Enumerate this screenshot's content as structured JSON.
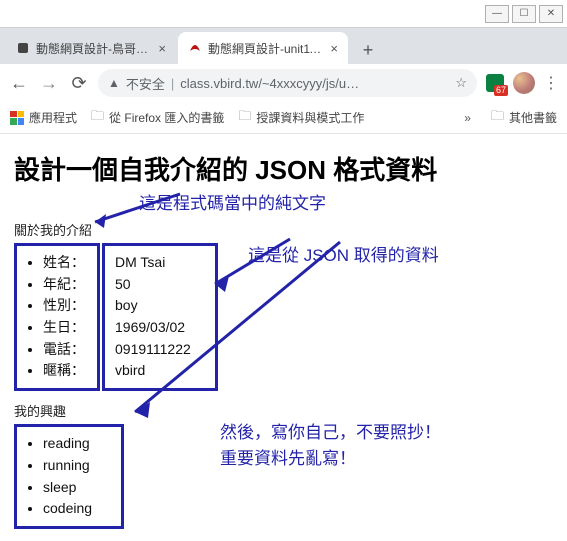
{
  "window": {
    "min": "—",
    "max": "☐",
    "close": "✕"
  },
  "tabs": [
    {
      "title": "動態網頁設計-鳥哥設…",
      "active": false
    },
    {
      "title": "動態網頁設計-unit11-1…",
      "active": true
    }
  ],
  "newtab": "+",
  "nav": {
    "back": "←",
    "forward": "→",
    "reload": "⟳"
  },
  "addr": {
    "insecure": "不安全",
    "url": "class.vbird.tw/~4xxxcyyy/js/u…",
    "star": "☆"
  },
  "ext": {
    "badge": "67"
  },
  "menu": "⋮",
  "bookmarks": {
    "apps": "應用程式",
    "firefox": "從 Firefox 匯入的書籤",
    "teach": "授課資料與模式工作",
    "overflow": "»",
    "other": "其他書籤"
  },
  "page": {
    "h1": "設計一個自我介紹的 JSON 格式資料",
    "ann_top": "這是程式碼當中的純文字",
    "section1": "關於我的介紹",
    "keys": [
      "姓名：",
      "年紀：",
      "性別：",
      "生日：",
      "電話：",
      "暱稱："
    ],
    "vals": [
      "DM Tsai",
      "50",
      "boy",
      "1969/03/02",
      "0919111222",
      "vbird"
    ],
    "ann_right": "這是從 JSON 取得的資料",
    "section2": "我的興趣",
    "hobbies": [
      "reading",
      "running",
      "sleep",
      "codeing"
    ],
    "ann_bottom_l1": "然後，寫你自己，不要照抄！",
    "ann_bottom_l2": "重要資料先亂寫！"
  }
}
